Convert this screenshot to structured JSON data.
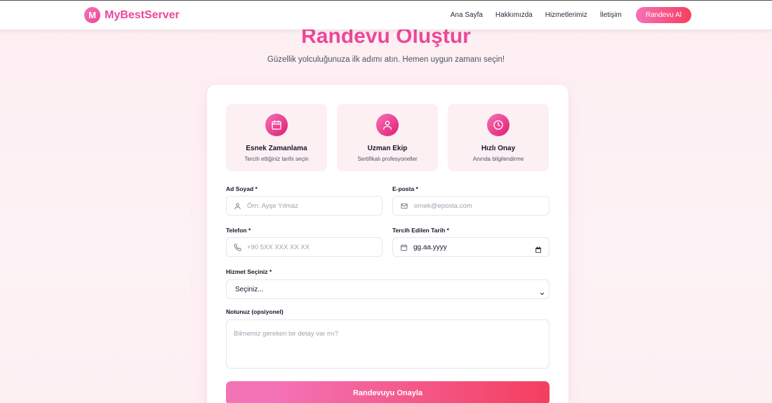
{
  "brand": {
    "logo_letter": "M",
    "name": "MyBestServer"
  },
  "nav": {
    "links": [
      "Ana Sayfa",
      "Hakkımızda",
      "Hizmetlerimiz",
      "İletişim"
    ],
    "cta": "Randevu Al"
  },
  "header": {
    "title": "Randevu Oluştur",
    "subtitle": "Güzellik yolculuğunuza ilk adımı atın. Hemen uygun zamanı seçin!"
  },
  "features": [
    {
      "icon": "calendar-icon",
      "title": "Esnek Zamanlama",
      "desc": "Tercih ettiğiniz tarihi seçin"
    },
    {
      "icon": "user-icon",
      "title": "Uzman Ekip",
      "desc": "Sertifikalı profesyoneller"
    },
    {
      "icon": "clock-icon",
      "title": "Hızlı Onay",
      "desc": "Anında bilgilendirme"
    }
  ],
  "form": {
    "name": {
      "label": "Ad Soyad *",
      "placeholder": "Örn: Ayşe Yılmaz"
    },
    "email": {
      "label": "E-posta *",
      "placeholder": "ornek@eposta.com"
    },
    "phone": {
      "label": "Telefon *",
      "placeholder": "+90 5XX XXX XX XX"
    },
    "date": {
      "label": "Tercih Edilen Tarih *",
      "value": "gg.aa.yyyy"
    },
    "service": {
      "label": "Hizmet Seçiniz *",
      "value": "Seçiniz..."
    },
    "note": {
      "label": "Notunuz (opsiyonel)",
      "placeholder": "Bilmemiz gereken bir detay var mı?"
    },
    "submit": "Randevuyu Onayla"
  },
  "colors": {
    "accent": "#ec4899",
    "accent_end": "#f43f5e",
    "feature_bg": "#fdf0f3"
  }
}
